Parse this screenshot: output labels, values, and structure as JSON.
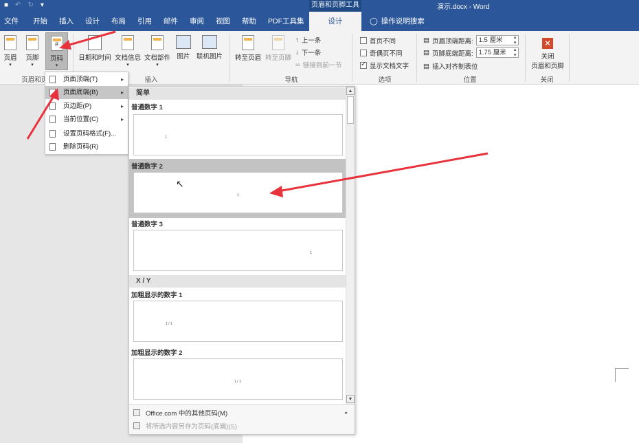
{
  "title_bar": {
    "qat_icons": [
      "save-icon",
      "undo-icon",
      "redo-icon",
      "customize-icon"
    ],
    "context_tool_title": "页眉和页脚工具",
    "document_title": "演示.docx  -  Word"
  },
  "tabs": {
    "file": "文件",
    "home": "开始",
    "insert": "插入",
    "design": "设计",
    "layout": "布局",
    "references": "引用",
    "mailings": "邮件",
    "review": "审阅",
    "view": "视图",
    "help": "帮助",
    "pdf": "PDF工具集",
    "design_active": "设计",
    "search": "操作说明搜索"
  },
  "ribbon": {
    "header": "页眉",
    "footer": "页脚",
    "page_number": "页码",
    "group_header_footer": "页眉和页脚",
    "date_time": "日期和时间",
    "doc_info": "文档信息",
    "doc_parts": "文档部件",
    "picture": "图片",
    "online_picture": "联机图片",
    "group_insert": "插入",
    "goto_header": "转至页眉",
    "goto_footer": "转至页脚",
    "prev": "上一条",
    "next": "下一条",
    "link_prev": "链接到前一节",
    "group_nav": "导航",
    "diff_first": "首页不同",
    "diff_odd_even": "奇偶页不同",
    "show_doc_text": "显示文档文字",
    "group_options": "选项",
    "header_top_label": "页眉顶端距离:",
    "header_top_value": "1.5 厘米",
    "footer_bottom_label": "页脚底端距离:",
    "footer_bottom_value": "1.75 厘米",
    "insert_align_tab": "插入对齐制表位",
    "group_position": "位置",
    "close_line1": "关闭",
    "close_line2": "页眉和页脚",
    "group_close": "关闭"
  },
  "page_number_menu": {
    "top": "页面顶端(T)",
    "bottom": "页面底端(B)",
    "margins": "页边距(P)",
    "current": "当前位置(C)",
    "format": "设置页码格式(F)...",
    "remove": "删除页码(R)"
  },
  "gallery": {
    "section_simple": "简单",
    "plain1": "普通数字 1",
    "plain2": "普通数字 2",
    "plain3": "普通数字 3",
    "section_xy": "X / Y",
    "bold1": "加粗显示的数字 1",
    "bold2": "加粗显示的数字 2",
    "thumb_num": "1",
    "thumb_xy": "1 / 1",
    "footer_more": "Office.com 中的其他页码(M)",
    "footer_save": "将所选内容另存为页码(底端)(S)"
  },
  "colors": {
    "accent": "#2b579a",
    "annotation_arrow": "#e8323c"
  }
}
